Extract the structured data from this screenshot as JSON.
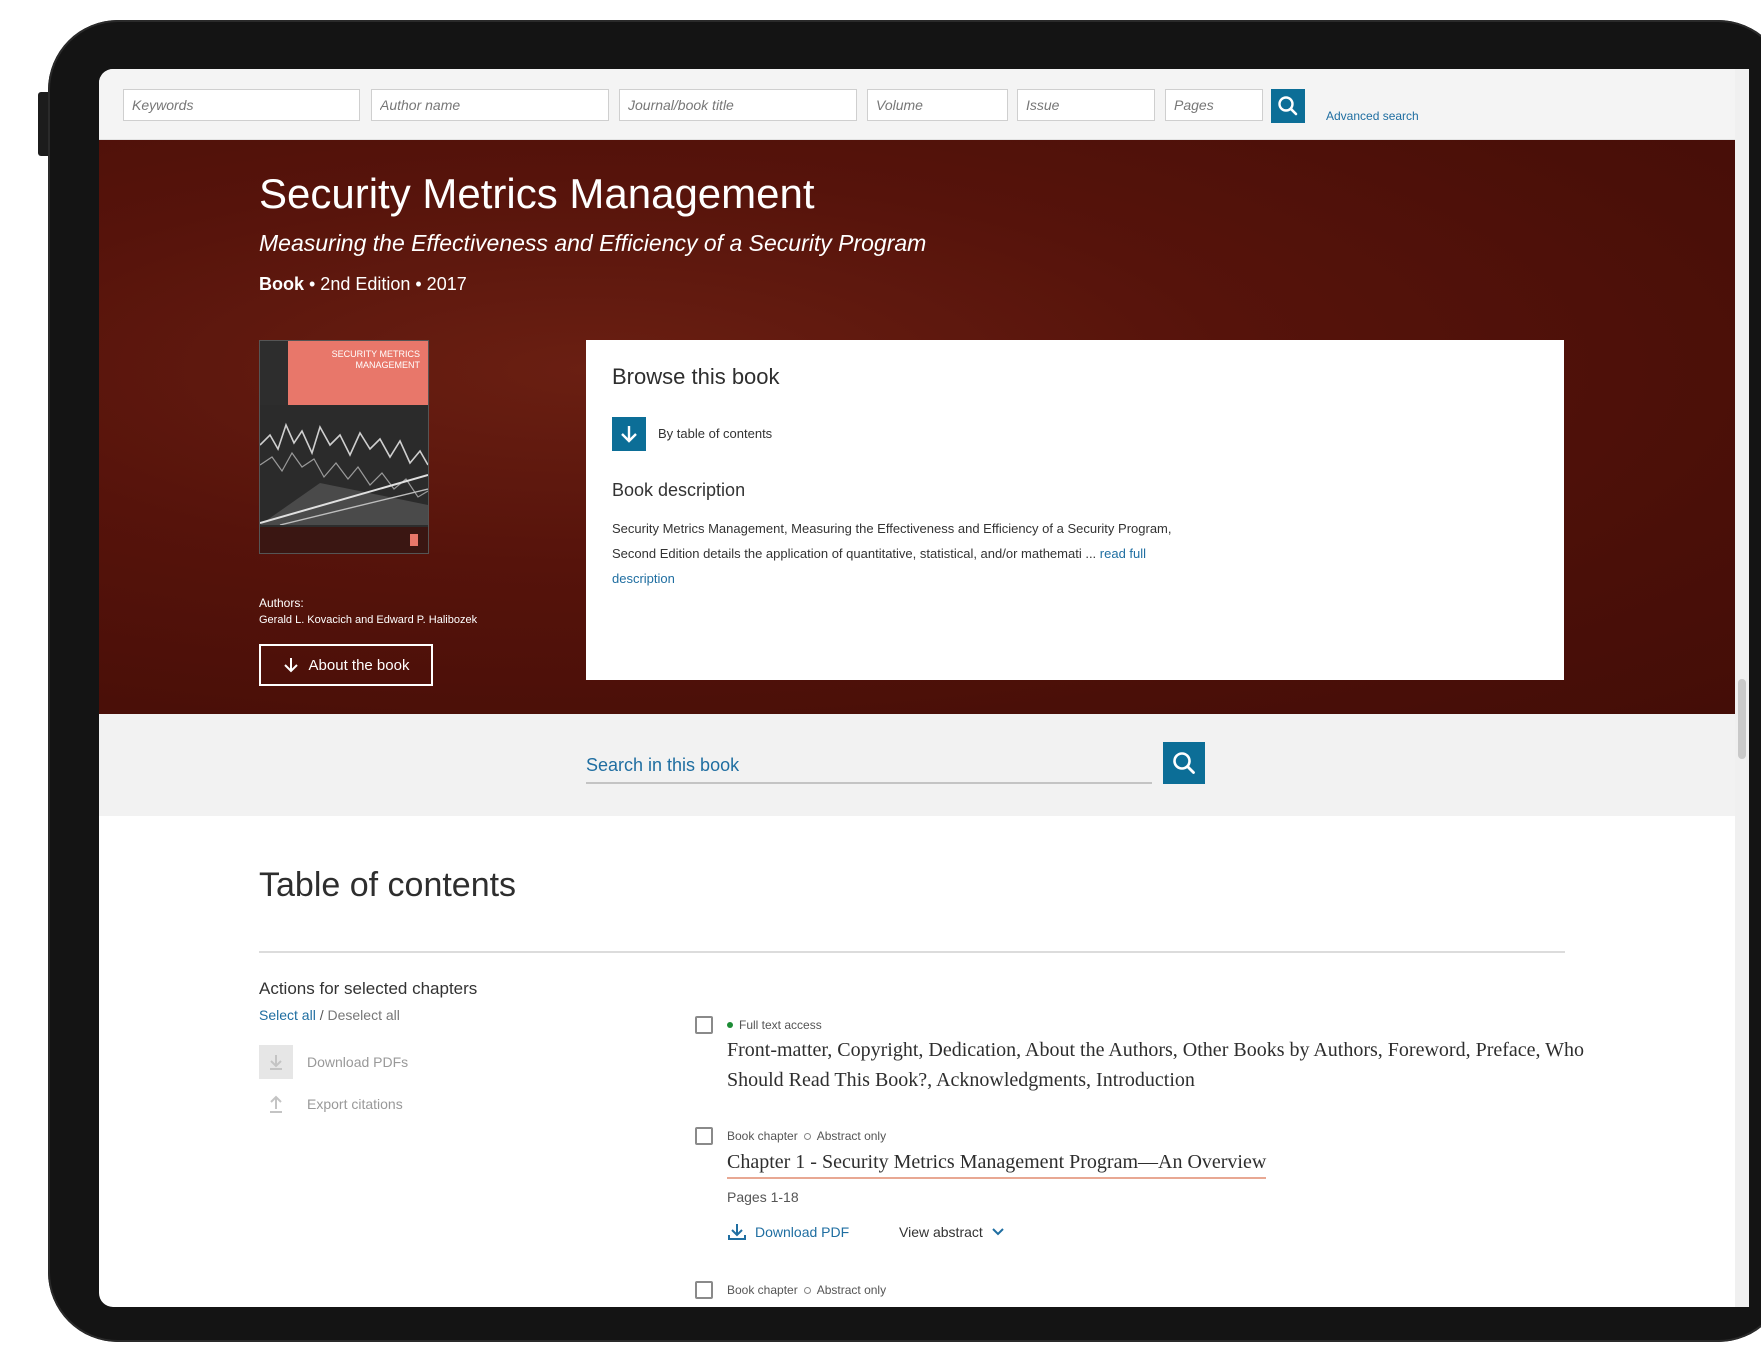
{
  "search": {
    "keywords_placeholder": "Keywords",
    "author_placeholder": "Author name",
    "journal_placeholder": "Journal/book title",
    "volume_placeholder": "Volume",
    "issue_placeholder": "Issue",
    "pages_placeholder": "Pages",
    "advanced_link": "Advanced search"
  },
  "book": {
    "title": "Security Metrics Management",
    "subtitle": "Measuring the Effectiveness and Efficiency of a Security Program",
    "type": "Book",
    "meta": " • 2nd Edition • 2017",
    "cover_title": "SECURITY METRICS MANAGEMENT",
    "authors_label": "Authors:",
    "authors": "Gerald L. Kovacich and Edward P. Halibozek",
    "about_label": "About the book"
  },
  "browse": {
    "title": "Browse this book",
    "toc_label": "By table of contents",
    "description_title": "Book description",
    "description_text": "Security Metrics Management, Measuring the Effectiveness and Efficiency of a Security Program, Second Edition details the application of quantitative, statistical, and/or mathemati ... ",
    "read_more": "read full description"
  },
  "inbook_search": {
    "placeholder": "Search in this book"
  },
  "toc": {
    "heading": "Table of contents",
    "actions_title": "Actions for selected chapters",
    "select_all": "Select all",
    "separator": " / ",
    "deselect_all": "Deselect all",
    "download_pdfs": "Download PDFs",
    "export_citations": "Export citations",
    "entries": [
      {
        "tags": "Full text access",
        "title": "Front-matter, Copyright, Dedication, About the Authors, Other Books by Authors, Foreword, Preface, Who Should Read This Book?, Acknowledgments, Introduction"
      },
      {
        "type": "Book chapter",
        "access": "Abstract only",
        "title": "Chapter 1 - Security Metrics Management Program—An Overview",
        "pages": "Pages 1-18",
        "download": "Download PDF",
        "view_abstract": "View abstract"
      },
      {
        "type": "Book chapter",
        "access": "Abstract only"
      }
    ]
  },
  "colors": {
    "accent": "#0c6e97",
    "hero": "#56130b",
    "link": "#1f6ea1",
    "access_dot": "#1c8c35"
  }
}
